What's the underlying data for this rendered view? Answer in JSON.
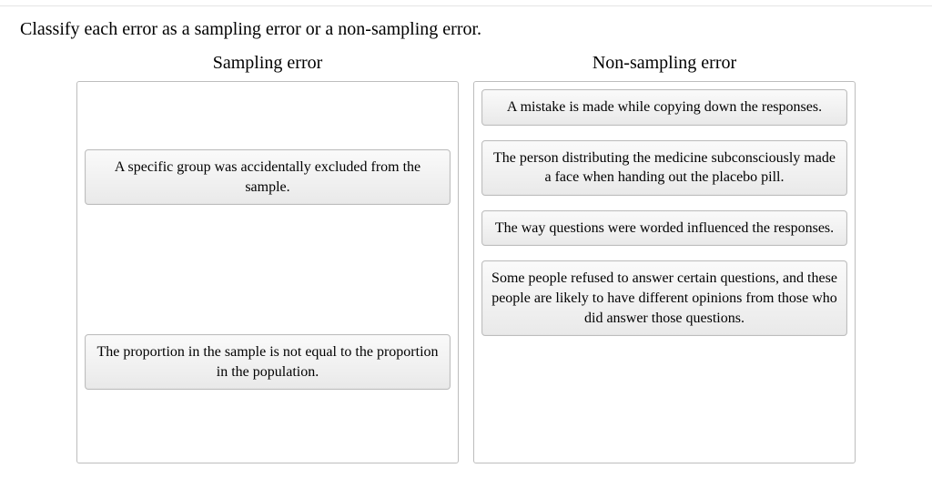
{
  "prompt": "Classify each error as a sampling error or a non-sampling error.",
  "columns": {
    "left": {
      "heading": "Sampling error",
      "items": [
        "A specific group was accidentally excluded from the sample.",
        "The proportion in the sample is not equal to the proportion in the population."
      ]
    },
    "right": {
      "heading": "Non-sampling error",
      "items": [
        "A mistake is made while copying down the responses.",
        "The person distributing the medicine subconsciously made a face when handing out the placebo pill.",
        "The way questions were worded influenced the responses.",
        "Some people refused to answer certain questions, and these people are likely to have different opinions from those who did answer those questions."
      ]
    }
  }
}
